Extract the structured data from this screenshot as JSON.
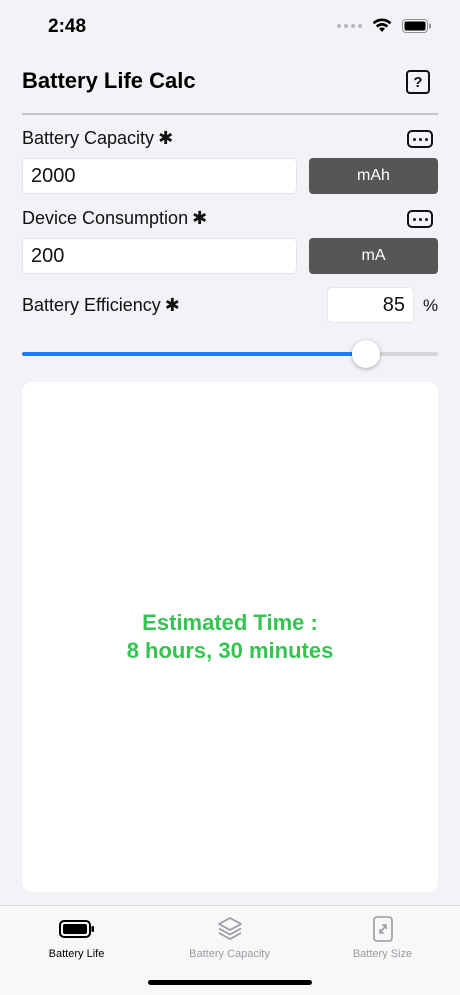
{
  "status_bar": {
    "time": "2:48"
  },
  "header": {
    "title": "Battery Life Calc",
    "help_label": "?"
  },
  "fields": {
    "capacity": {
      "label": "Battery Capacity",
      "required": "✱",
      "value": "2000",
      "unit": "mAh"
    },
    "consumption": {
      "label": "Device Consumption",
      "required": "✱",
      "value": "200",
      "unit": "mA"
    },
    "efficiency": {
      "label": "Battery Efficiency",
      "required": "✱",
      "value": "85",
      "unit": "%",
      "slider_fraction": 0.85
    }
  },
  "result": {
    "line1": "Estimated Time :",
    "line2": "8 hours, 30 minutes"
  },
  "tabs": [
    {
      "label": "Battery Life",
      "icon": "battery-icon",
      "active": true
    },
    {
      "label": "Battery Capacity",
      "icon": "layers-icon",
      "active": false
    },
    {
      "label": "Battery Size",
      "icon": "resize-icon",
      "active": false
    }
  ],
  "colors": {
    "accent": "#1a7ff5",
    "result": "#34c44f",
    "unit_button": "#565656",
    "tab_inactive": "#9a9a9f"
  }
}
